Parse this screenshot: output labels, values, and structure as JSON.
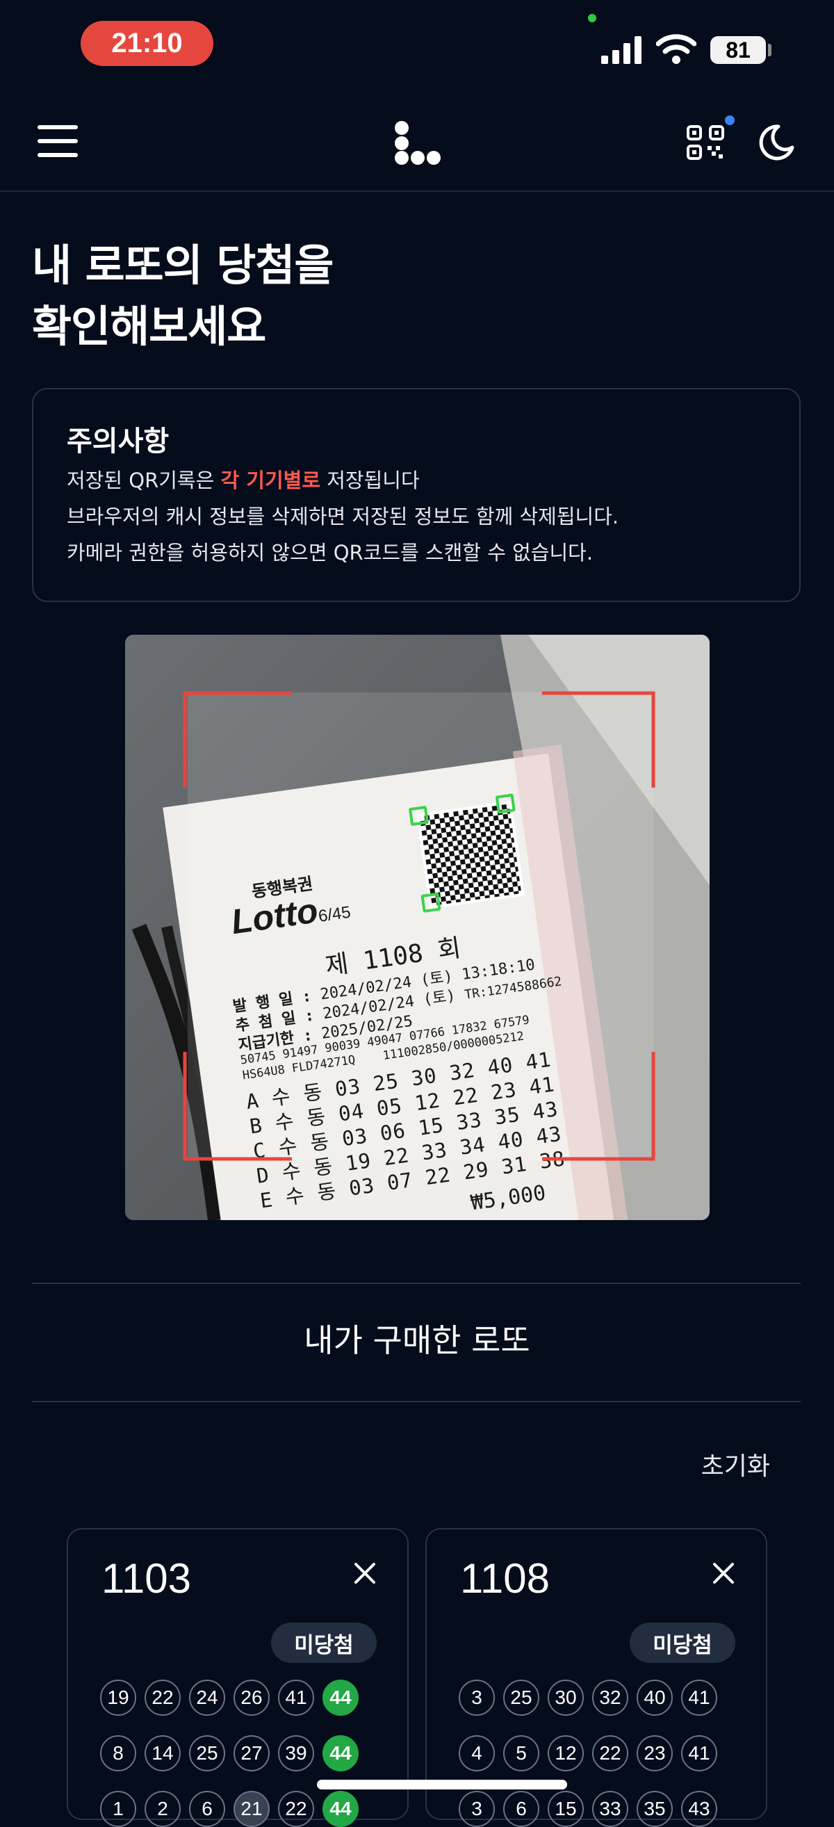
{
  "status_bar": {
    "time": "21:10",
    "battery": "81"
  },
  "header": {
    "menu_icon": "hamburger-menu-icon",
    "logo_icon": "dots-logo",
    "qr_icon": "qr-code-icon",
    "theme_icon": "moon-icon"
  },
  "page": {
    "title_line1": "내 로또의 당첨을",
    "title_line2": "확인해보세요"
  },
  "notice": {
    "title": "주의사항",
    "line1_before": "저장된 QR기록은 ",
    "line1_highlight": "각 기기별로",
    "line1_after": " 저장됩니다",
    "line2": "브라우저의 캐시 정보를 삭제하면 저장된 정보도 함께 삭제됩니다.",
    "line3": "카메라 권한을 허용하지 않으면 QR코드를 스캔할 수 없습니다."
  },
  "scanner": {
    "frame_color": "#e5473e",
    "ticket": {
      "brand_small": "동행복권",
      "brand": "Lotto",
      "brand_sub": "6/45",
      "round": "제 1108 회",
      "issue_label": "발 행 일 :",
      "issue_date": "2024/02/24 (토)",
      "issue_time": "13:18:10",
      "draw_label": "추 첨 일 :",
      "draw_date": "2024/02/24 (토)",
      "tr": "TR:1274588662",
      "pay_label": "지급기한 :",
      "pay_date": "2025/02/25",
      "code1": "50745 91497 90039 49047 07766 17832 67579",
      "code2": "HS64U8 FLD74271Q",
      "code3": "111002850/0000005212",
      "rows": [
        "A 수 동 03 25 30 32 40 41",
        "B 수 동 04 05 12 22 23 41",
        "C 수 동 03 06 15 33 35 43",
        "D 수 동 19 22 33 34 40 43",
        "E 수 동 03 07 22 29 31 38"
      ],
      "price": "₩5,000",
      "bottom_code": "49047 07766 17832 67579"
    }
  },
  "my_lotto": {
    "title": "내가 구매한 로또",
    "reset_label": "초기화",
    "tickets": [
      {
        "round": "1103",
        "status": "미당첨",
        "rows": [
          [
            {
              "n": "19",
              "s": ""
            },
            {
              "n": "22",
              "s": ""
            },
            {
              "n": "24",
              "s": ""
            },
            {
              "n": "26",
              "s": ""
            },
            {
              "n": "41",
              "s": ""
            },
            {
              "n": "44",
              "s": "hit"
            }
          ],
          [
            {
              "n": "8",
              "s": ""
            },
            {
              "n": "14",
              "s": ""
            },
            {
              "n": "25",
              "s": ""
            },
            {
              "n": "27",
              "s": ""
            },
            {
              "n": "39",
              "s": ""
            },
            {
              "n": "44",
              "s": "hit"
            }
          ],
          [
            {
              "n": "1",
              "s": ""
            },
            {
              "n": "2",
              "s": ""
            },
            {
              "n": "6",
              "s": ""
            },
            {
              "n": "21",
              "s": "gray"
            },
            {
              "n": "22",
              "s": ""
            },
            {
              "n": "44",
              "s": "hit"
            }
          ]
        ]
      },
      {
        "round": "1108",
        "status": "미당첨",
        "rows": [
          [
            {
              "n": "3",
              "s": ""
            },
            {
              "n": "25",
              "s": ""
            },
            {
              "n": "30",
              "s": ""
            },
            {
              "n": "32",
              "s": ""
            },
            {
              "n": "40",
              "s": ""
            },
            {
              "n": "41",
              "s": ""
            }
          ],
          [
            {
              "n": "4",
              "s": ""
            },
            {
              "n": "5",
              "s": ""
            },
            {
              "n": "12",
              "s": ""
            },
            {
              "n": "22",
              "s": ""
            },
            {
              "n": "23",
              "s": ""
            },
            {
              "n": "41",
              "s": ""
            }
          ],
          [
            {
              "n": "3",
              "s": ""
            },
            {
              "n": "6",
              "s": ""
            },
            {
              "n": "15",
              "s": ""
            },
            {
              "n": "33",
              "s": ""
            },
            {
              "n": "35",
              "s": ""
            },
            {
              "n": "43",
              "s": ""
            }
          ]
        ]
      }
    ]
  }
}
